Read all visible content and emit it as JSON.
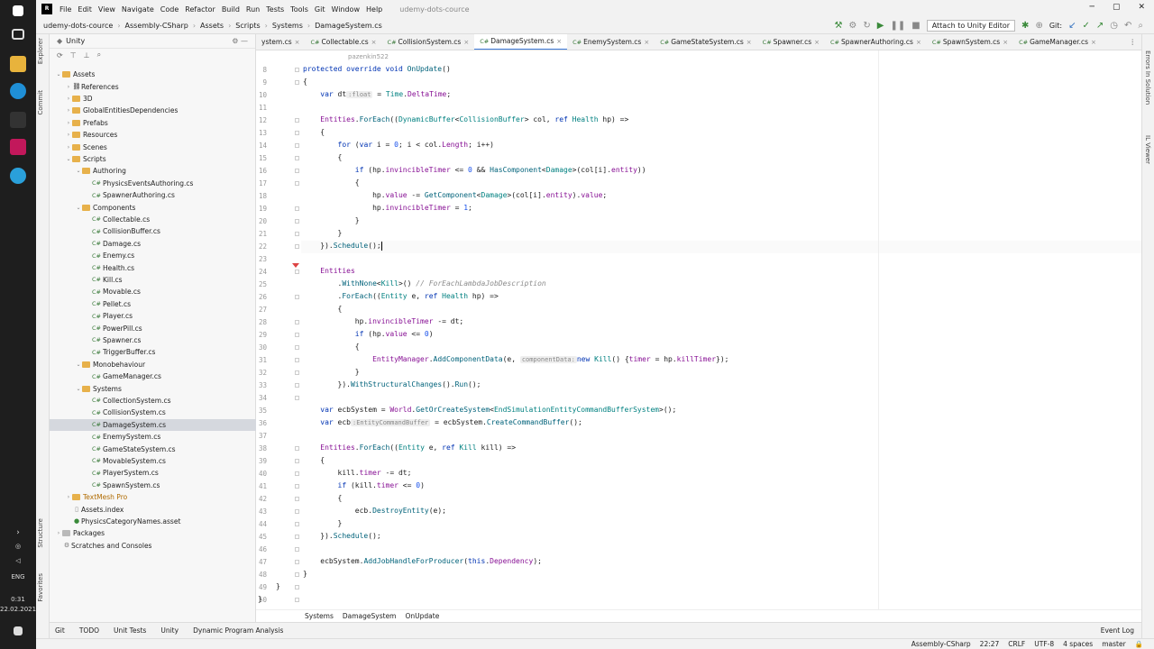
{
  "os": {
    "lang": "ENG",
    "time": "0:31",
    "date": "22.02.2021"
  },
  "menu": {
    "items": [
      "File",
      "Edit",
      "View",
      "Navigate",
      "Code",
      "Refactor",
      "Build",
      "Run",
      "Tests",
      "Tools",
      "Git",
      "Window",
      "Help"
    ],
    "project_title": "udemy-dots-cource"
  },
  "nav": {
    "crumbs": [
      "udemy-dots-cource",
      "Assembly-CSharp",
      "Assets",
      "Scripts",
      "Systems",
      "DamageSystem.cs"
    ],
    "attach": "Attach to Unity Editor",
    "git_label": "Git:"
  },
  "side_labels": {
    "explorer": "Explorer",
    "commit": "Commit",
    "structure": "Structure",
    "favorites": "Favorites"
  },
  "right_labels": {
    "errors": "Errors In Solution",
    "il": "IL Viewer"
  },
  "project": {
    "header": "Unity",
    "tree": [
      {
        "label": "Assets",
        "depth": 0,
        "arrow": "open",
        "icon": "folder"
      },
      {
        "label": "References",
        "depth": 1,
        "arrow": "closed",
        "icon": "ref"
      },
      {
        "label": "3D",
        "depth": 1,
        "arrow": "closed",
        "icon": "folder"
      },
      {
        "label": "GlobalEntitiesDependencies",
        "depth": 1,
        "arrow": "closed",
        "icon": "folder"
      },
      {
        "label": "Prefabs",
        "depth": 1,
        "arrow": "closed",
        "icon": "folder"
      },
      {
        "label": "Resources",
        "depth": 1,
        "arrow": "closed",
        "icon": "folder"
      },
      {
        "label": "Scenes",
        "depth": 1,
        "arrow": "closed",
        "icon": "folder"
      },
      {
        "label": "Scripts",
        "depth": 1,
        "arrow": "open",
        "icon": "folder"
      },
      {
        "label": "Authoring",
        "depth": 2,
        "arrow": "open",
        "icon": "folder"
      },
      {
        "label": "PhysicsEventsAuthoring.cs",
        "depth": 3,
        "arrow": "",
        "icon": "cs"
      },
      {
        "label": "SpawnerAuthoring.cs",
        "depth": 3,
        "arrow": "",
        "icon": "cs"
      },
      {
        "label": "Components",
        "depth": 2,
        "arrow": "open",
        "icon": "folder"
      },
      {
        "label": "Collectable.cs",
        "depth": 3,
        "arrow": "",
        "icon": "cs"
      },
      {
        "label": "CollisionBuffer.cs",
        "depth": 3,
        "arrow": "",
        "icon": "cs"
      },
      {
        "label": "Damage.cs",
        "depth": 3,
        "arrow": "",
        "icon": "cs"
      },
      {
        "label": "Enemy.cs",
        "depth": 3,
        "arrow": "",
        "icon": "cs"
      },
      {
        "label": "Health.cs",
        "depth": 3,
        "arrow": "",
        "icon": "cs"
      },
      {
        "label": "Kill.cs",
        "depth": 3,
        "arrow": "",
        "icon": "cs"
      },
      {
        "label": "Movable.cs",
        "depth": 3,
        "arrow": "",
        "icon": "cs"
      },
      {
        "label": "Pellet.cs",
        "depth": 3,
        "arrow": "",
        "icon": "cs"
      },
      {
        "label": "Player.cs",
        "depth": 3,
        "arrow": "",
        "icon": "cs"
      },
      {
        "label": "PowerPill.cs",
        "depth": 3,
        "arrow": "",
        "icon": "cs"
      },
      {
        "label": "Spawner.cs",
        "depth": 3,
        "arrow": "",
        "icon": "cs"
      },
      {
        "label": "TriggerBuffer.cs",
        "depth": 3,
        "arrow": "",
        "icon": "cs"
      },
      {
        "label": "Monobehaviour",
        "depth": 2,
        "arrow": "open",
        "icon": "folder"
      },
      {
        "label": "GameManager.cs",
        "depth": 3,
        "arrow": "",
        "icon": "cs"
      },
      {
        "label": "Systems",
        "depth": 2,
        "arrow": "open",
        "icon": "folder"
      },
      {
        "label": "CollectionSystem.cs",
        "depth": 3,
        "arrow": "",
        "icon": "cs"
      },
      {
        "label": "CollisionSystem.cs",
        "depth": 3,
        "arrow": "",
        "icon": "cs"
      },
      {
        "label": "DamageSystem.cs",
        "depth": 3,
        "arrow": "",
        "icon": "cs",
        "selected": true
      },
      {
        "label": "EnemySystem.cs",
        "depth": 3,
        "arrow": "",
        "icon": "cs"
      },
      {
        "label": "GameStateSystem.cs",
        "depth": 3,
        "arrow": "",
        "icon": "cs"
      },
      {
        "label": "MovableSystem.cs",
        "depth": 3,
        "arrow": "",
        "icon": "cs"
      },
      {
        "label": "PlayerSystem.cs",
        "depth": 3,
        "arrow": "",
        "icon": "cs"
      },
      {
        "label": "SpawnSystem.cs",
        "depth": 3,
        "arrow": "",
        "icon": "cs"
      },
      {
        "label": "TextMesh Pro",
        "depth": 1,
        "arrow": "closed",
        "icon": "folder"
      },
      {
        "label": "Assets.index",
        "depth": 1,
        "arrow": "",
        "icon": "file"
      },
      {
        "label": "PhysicsCategoryNames.asset",
        "depth": 1,
        "arrow": "",
        "icon": "asset"
      },
      {
        "label": "Packages",
        "depth": 0,
        "arrow": "closed",
        "icon": "folder"
      },
      {
        "label": "Scratches and Consoles",
        "depth": 0,
        "arrow": "",
        "icon": "scratch"
      }
    ]
  },
  "tabs": [
    {
      "label": "ystem.cs",
      "active": false
    },
    {
      "label": "Collectable.cs",
      "active": false
    },
    {
      "label": "CollisionSystem.cs",
      "active": false
    },
    {
      "label": "DamageSystem.cs",
      "active": true
    },
    {
      "label": "EnemySystem.cs",
      "active": false
    },
    {
      "label": "GameStateSystem.cs",
      "active": false
    },
    {
      "label": "Spawner.cs",
      "active": false
    },
    {
      "label": "SpawnerAuthoring.cs",
      "active": false
    },
    {
      "label": "SpawnSystem.cs",
      "active": false
    },
    {
      "label": "GameManager.cs",
      "active": false
    }
  ],
  "editor": {
    "author": "pazenkin522",
    "line_numbers": [
      "8",
      "9",
      "10",
      "11",
      "12",
      "13",
      "14",
      "15",
      "16",
      "17",
      "18",
      "19",
      "20",
      "21",
      "22",
      "23",
      "24",
      "25",
      "26",
      "27",
      "28",
      "29",
      "30",
      "31",
      "32",
      "33",
      "34",
      "35",
      "36",
      "37",
      "38",
      "39",
      "40",
      "41",
      "42",
      "43",
      "44",
      "45",
      "46",
      "47",
      "48",
      "49",
      "50"
    ]
  },
  "breadcrumb": [
    "Systems",
    "DamageSystem",
    "OnUpdate"
  ],
  "bottom_tools": [
    "Git",
    "TODO",
    "Unit Tests",
    "Unity",
    "Dynamic Program Analysis"
  ],
  "event_log": "Event Log",
  "status": {
    "assembly": "Assembly-CSharp",
    "pos": "22:27",
    "eol": "CRLF",
    "enc": "UTF-8",
    "indent": "4 spaces",
    "branch": "master"
  }
}
